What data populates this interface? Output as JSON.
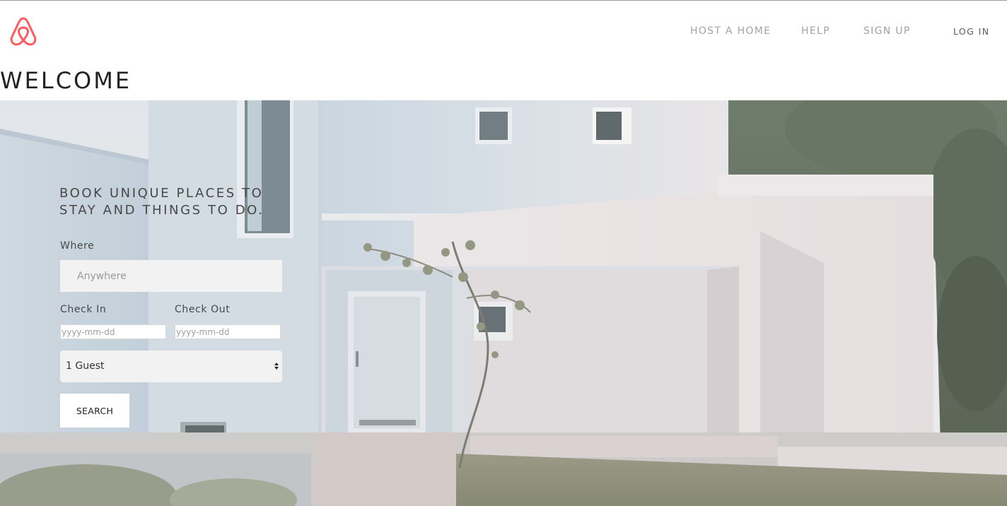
{
  "header": {
    "logo_icon": "airbnb-belo-icon",
    "logo_color": "#ff5a5f",
    "nav": {
      "host_a_home": "HOST A HOME",
      "help": "HELP",
      "sign_up": "SIGN UP",
      "log_in": "LOG IN"
    }
  },
  "page_title": "WELCOME",
  "hero": {
    "tagline": "BOOK UNIQUE PLACES TO STAY AND THINGS TO DO.",
    "form": {
      "where_label": "Where",
      "where_placeholder": "Anywhere",
      "where_value": "",
      "check_in_label": "Check In",
      "check_in_placeholder": "yyyy-mm-dd",
      "check_out_label": "Check Out",
      "check_out_placeholder": "yyyy-mm-dd",
      "guests_selected": "1 Guest",
      "search_label": "SEARCH"
    }
  }
}
